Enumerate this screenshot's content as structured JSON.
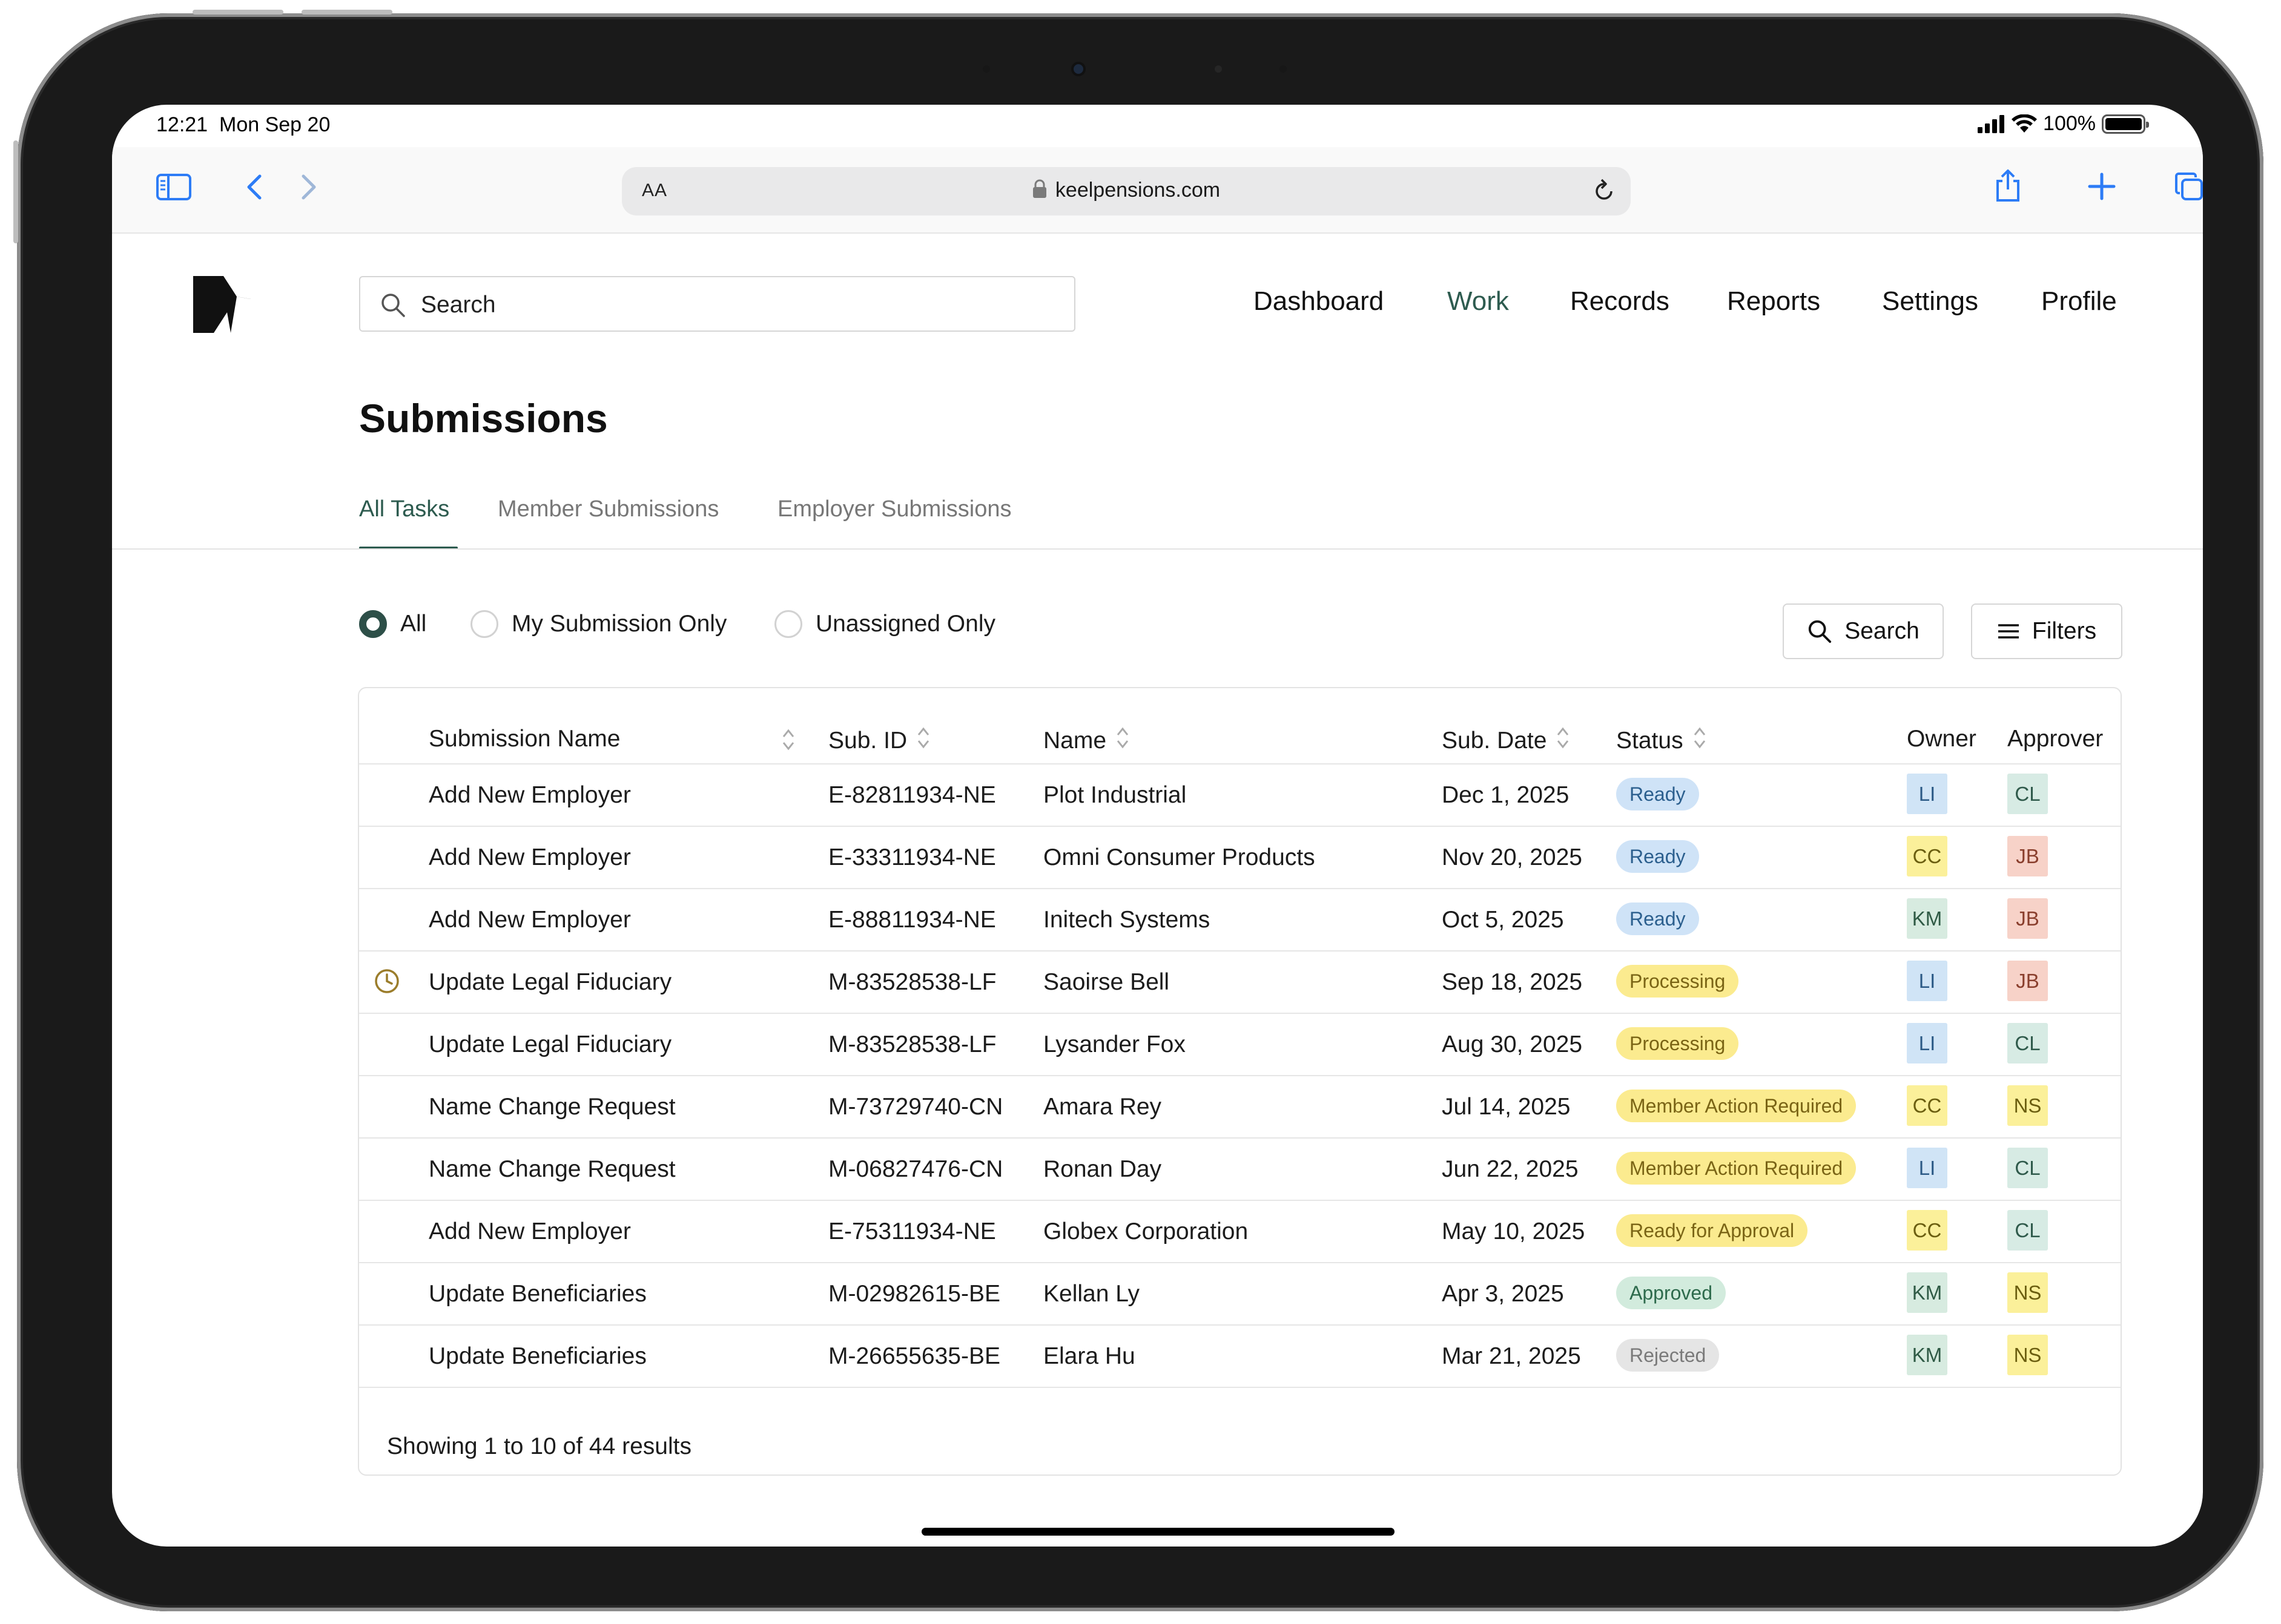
{
  "status_bar": {
    "time": "12:21",
    "date": "Mon Sep 20",
    "battery": "100%"
  },
  "browser": {
    "text_size_label": "AA",
    "url": "keelpensions.com"
  },
  "header": {
    "search_placeholder": "Search",
    "nav": [
      "Dashboard",
      "Work",
      "Records",
      "Reports",
      "Settings",
      "Profile"
    ],
    "active_nav": "Work"
  },
  "page": {
    "title": "Submissions",
    "tabs": [
      "All Tasks",
      "Member Submissions",
      "Employer Submissions"
    ],
    "active_tab": "All Tasks"
  },
  "filters": {
    "radios": [
      "All",
      "My Submission Only",
      "Unassigned Only"
    ],
    "selected": "All",
    "search_button": "Search",
    "filters_button": "Filters"
  },
  "table": {
    "columns": [
      "Submission Name",
      "Sub. ID",
      "Name",
      "Sub. Date",
      "Status",
      "Owner",
      "Approver"
    ],
    "rows": [
      {
        "name": "Add New Employer",
        "id": "E-82811934-NE",
        "person": "Plot Industrial",
        "date": "Dec 1, 2025",
        "status": "Ready",
        "owner": "LI",
        "approver": "CL"
      },
      {
        "name": "Add New Employer",
        "id": "E-33311934-NE",
        "person": "Omni Consumer Products",
        "date": "Nov 20, 2025",
        "status": "Ready",
        "owner": "CC",
        "approver": "JB"
      },
      {
        "name": "Add New Employer",
        "id": "E-88811934-NE",
        "person": "Initech Systems",
        "date": "Oct 5, 2025",
        "status": "Ready",
        "owner": "KM",
        "approver": "JB"
      },
      {
        "name": "Update Legal Fiduciary",
        "id": "M-83528538-LF",
        "person": "Saoirse Bell",
        "date": "Sep 18, 2025",
        "status": "Processing",
        "owner": "LI",
        "approver": "JB"
      },
      {
        "name": "Update Legal Fiduciary",
        "id": "M-83528538-LF",
        "person": "Lysander Fox",
        "date": "Aug 30, 2025",
        "status": "Processing",
        "owner": "LI",
        "approver": "CL"
      },
      {
        "name": "Name Change Request",
        "id": "M-73729740-CN",
        "person": "Amara Rey",
        "date": "Jul 14, 2025",
        "status": "Member Action Required",
        "owner": "CC",
        "approver": "NS"
      },
      {
        "name": "Name Change Request",
        "id": "M-06827476-CN",
        "person": "Ronan Day",
        "date": "Jun 22, 2025",
        "status": "Member Action Required",
        "owner": "LI",
        "approver": "CL"
      },
      {
        "name": "Add New Employer",
        "id": "E-75311934-NE",
        "person": "Globex Corporation",
        "date": "May 10, 2025",
        "status": "Ready for Approval",
        "owner": "CC",
        "approver": "CL"
      },
      {
        "name": "Update Beneficiaries",
        "id": "M-02982615-BE",
        "person": "Kellan Ly",
        "date": "Apr 3, 2025",
        "status": "Approved",
        "owner": "KM",
        "approver": "NS"
      },
      {
        "name": "Update Beneficiaries",
        "id": "M-26655635-BE",
        "person": "Elara Hu",
        "date": "Mar 21, 2025",
        "status": "Rejected",
        "owner": "KM",
        "approver": "NS"
      }
    ],
    "footer": "Showing 1 to 10 of 44 results"
  },
  "colors": {
    "accent": "#2d5b4f",
    "ready": "#cfe3f7",
    "processing": "#fbeb8f",
    "approved": "#d2ebdd",
    "rejected": "#e5e5e5"
  }
}
